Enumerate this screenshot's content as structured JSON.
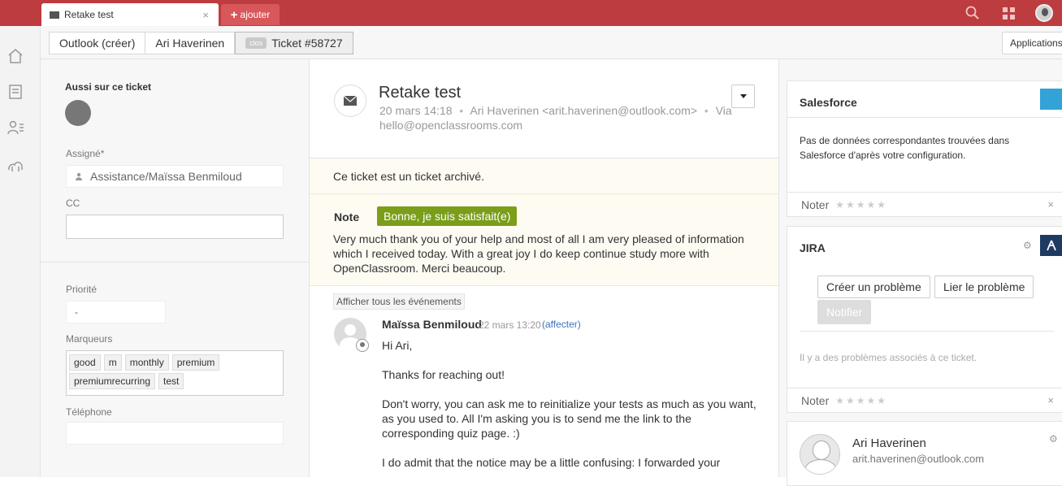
{
  "topbar": {
    "tab_label": "Retake test",
    "tab_close": "×",
    "add_label": "ajouter",
    "add_plus": "+"
  },
  "subtabs": [
    {
      "label": "Outlook (créer)"
    },
    {
      "label": "Ari Haverinen"
    },
    {
      "label": "Ticket #58727",
      "badge": "clos"
    }
  ],
  "apps_label": "Applications",
  "left": {
    "also_on_ticket": "Aussi sur ce ticket",
    "assignee_label": "Assigné*",
    "assignee_value": "Assistance/Maïssa Benmiloud",
    "cc_label": "CC",
    "priority_label": "Priorité",
    "priority_value": "-",
    "tags_label": "Marqueurs",
    "tags": [
      "good",
      "m",
      "monthly",
      "premium",
      "premiumrecurring",
      "test"
    ],
    "phone_label": "Téléphone"
  },
  "ticket": {
    "title": "Retake test",
    "meta_date": "20 mars 14:18",
    "meta_from": "Ari Haverinen <arit.haverinen@outlook.com>",
    "meta_via": "Via",
    "meta_via_addr": "hello@openclassrooms.com",
    "dot": "•",
    "archived_notice": "Ce ticket est un ticket archivé.",
    "note_label": "Note",
    "satisfaction": "Bonne, je suis satisfait(e)",
    "note_text": "Very much thank you of your help and most of all I am very pleased of information which I received today. With a great joy I do keep continue study more with OpenClassroom. Merci beaucoup.",
    "show_events": "Afficher tous les événements"
  },
  "message": {
    "author": "Maïssa Benmiloud",
    "date": "22 mars 13:20",
    "assign_link": "(affecter)",
    "paragraphs": [
      "Hi Ari,",
      "Thanks for reaching out!",
      "Don't worry, you can ask me to reinitialize your tests as much as you want, as you used to. All I'm asking you is to send me the link to the corresponding quiz page. :)",
      "I do admit that the notice may be a little confusing: I forwarded your"
    ]
  },
  "apps": {
    "salesforce": {
      "title": "Salesforce",
      "body": "Pas de données correspondantes trouvées dans Salesforce d'après votre configuration.",
      "rate_label": "Noter",
      "stars": "★★★★★",
      "close": "×"
    },
    "jira": {
      "title": "JIRA",
      "create_btn": "Créer un problème",
      "link_btn": "Lier le problème",
      "notify_btn": "Notifier",
      "info": "Il y a des problèmes associés à ce ticket.",
      "rate_label": "Noter",
      "stars": "★★★★★",
      "close": "×"
    },
    "user": {
      "name": "Ari Haverinen",
      "email": "arit.haverinen@outlook.com"
    }
  },
  "colors": {
    "brand": "#bd3c3f",
    "satisfied": "#7a9e1a",
    "link": "#3b73b9"
  }
}
